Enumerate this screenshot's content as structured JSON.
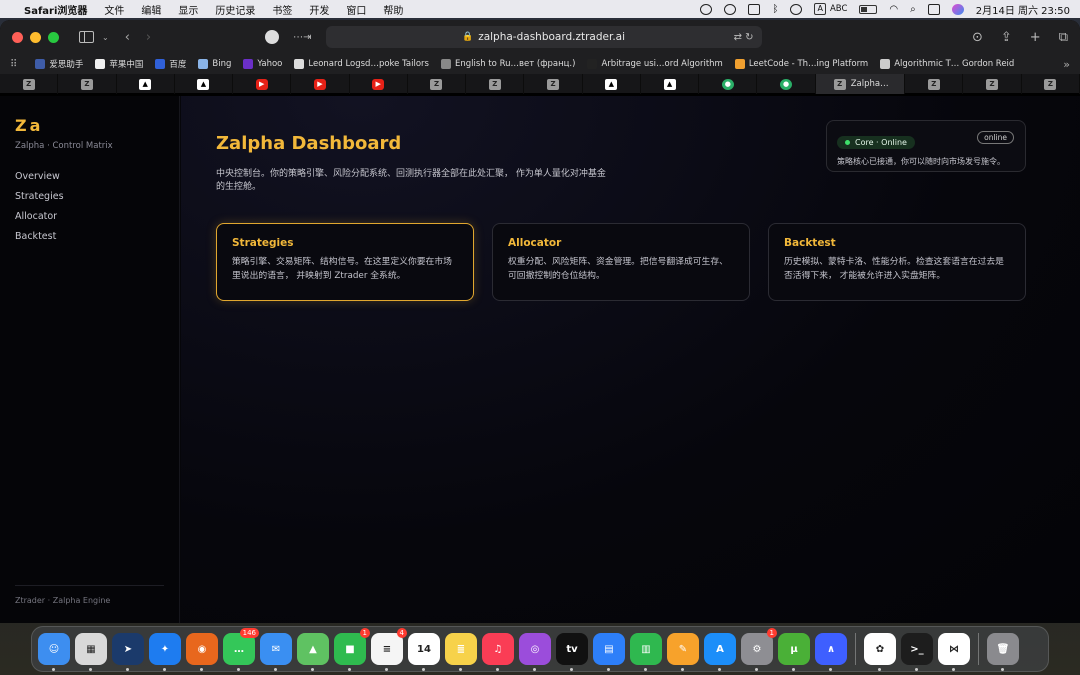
{
  "menubar": {
    "app_name": "Safari浏览器",
    "items": [
      "文件",
      "编辑",
      "显示",
      "历史记录",
      "书签",
      "开发",
      "窗口",
      "帮助"
    ],
    "input_method": "A",
    "input_label": "ABC",
    "datetime": "2月14日 周六 23:50"
  },
  "browser": {
    "url": "zalpha-dashboard.ztrader.ai",
    "bookmarks": [
      {
        "label": "爱思助手",
        "color": "#3e5ca8"
      },
      {
        "label": "苹果中国",
        "color": "#f0f0f0"
      },
      {
        "label": "百度",
        "color": "#3060d8"
      },
      {
        "label": "Bing",
        "color": "#8ab4e8"
      },
      {
        "label": "Yahoo",
        "color": "#6b2fc8"
      },
      {
        "label": "Leonard Logsd…poke Tailors",
        "color": "#dddddd"
      },
      {
        "label": "English to Ru…вет (франц.)",
        "color": "#888888"
      },
      {
        "label": "Arbitrage usi…ord Algorithm",
        "color": "#222222"
      },
      {
        "label": "LeetCode - Th…ing Platform",
        "color": "#f0a030"
      },
      {
        "label": "Algorithmic T… Gordon Reid",
        "color": "#cccccc"
      }
    ],
    "tabs": [
      {
        "type": "z",
        "glyph": "Z"
      },
      {
        "type": "z",
        "glyph": "Z"
      },
      {
        "type": "tri",
        "glyph": "▲"
      },
      {
        "type": "tri",
        "glyph": "▲"
      },
      {
        "type": "yt",
        "glyph": "▶"
      },
      {
        "type": "yt",
        "glyph": "▶"
      },
      {
        "type": "yt",
        "glyph": "▶"
      },
      {
        "type": "z",
        "glyph": "Z"
      },
      {
        "type": "z",
        "glyph": "Z"
      },
      {
        "type": "z",
        "glyph": "Z"
      },
      {
        "type": "tri",
        "glyph": "▲"
      },
      {
        "type": "tri",
        "glyph": "▲"
      },
      {
        "type": "wx",
        "glyph": "●"
      },
      {
        "type": "wx",
        "glyph": "●"
      },
      {
        "type": "z",
        "glyph": "Z",
        "label": "Zalpha…",
        "active": true
      },
      {
        "type": "z",
        "glyph": "Z"
      },
      {
        "type": "z",
        "glyph": "Z"
      },
      {
        "type": "z",
        "glyph": "Z"
      }
    ]
  },
  "sidebar": {
    "brand": "Za",
    "subtitle": "Zalpha · Control Matrix",
    "nav": [
      "Overview",
      "Strategies",
      "Allocator",
      "Backtest"
    ],
    "footer": "Ztrader · Zalpha Engine"
  },
  "main": {
    "title": "Zalpha Dashboard",
    "description": "中央控制台。你的策略引擎、风险分配系统、回测执行器全部在此处汇聚， 作为单人量化对冲基金的生控舱。",
    "status": {
      "pill": "Core · Online",
      "badge": "online",
      "text": "策略核心已接通，你可以随时向市场发号施令。"
    },
    "cards": [
      {
        "title": "Strategies",
        "desc": "策略引擎、交易矩阵、结构信号。在这里定义你要在市场里说出的语言， 并映射到 Ztrader 全系统。"
      },
      {
        "title": "Allocator",
        "desc": "权重分配、风险矩阵、资金管理。把信号翻译成可生存、可回撤控制的仓位结构。"
      },
      {
        "title": "Backtest",
        "desc": "历史模拟、蒙特卡洛、性能分析。检查这套语言在过去是否活得下来， 才能被允许进入实盘矩阵。"
      }
    ]
  },
  "dock": {
    "apps": [
      {
        "name": "finder",
        "color": "#3d8ef0",
        "glyph": "☺"
      },
      {
        "name": "launchpad",
        "color": "#d9d9d9",
        "glyph": "▦"
      },
      {
        "name": "navigator",
        "color": "#1b3a6b",
        "glyph": "➤"
      },
      {
        "name": "safari",
        "color": "#1e7cf0",
        "glyph": "✦"
      },
      {
        "name": "firefox",
        "color": "#e8671d",
        "glyph": "◉"
      },
      {
        "name": "messages",
        "color": "#34c759",
        "glyph": "…",
        "badge": "146"
      },
      {
        "name": "mail",
        "color": "#3a8ff2",
        "glyph": "✉"
      },
      {
        "name": "maps",
        "color": "#5fc262",
        "glyph": "▲"
      },
      {
        "name": "facetime",
        "color": "#2fbb4f",
        "glyph": "■",
        "badge": "1"
      },
      {
        "name": "reminders",
        "color": "#f5f5f5",
        "glyph": "≡",
        "badge": "4"
      },
      {
        "name": "calendar",
        "color": "#ffffff",
        "glyph": "14"
      },
      {
        "name": "notes",
        "color": "#f7d24a",
        "glyph": "≣"
      },
      {
        "name": "music",
        "color": "#fa3d55",
        "glyph": "♫"
      },
      {
        "name": "podcasts",
        "color": "#9b4ddb",
        "glyph": "◎"
      },
      {
        "name": "apple-tv",
        "color": "#111111",
        "glyph": "tv"
      },
      {
        "name": "keynote",
        "color": "#2d7ff9",
        "glyph": "▤"
      },
      {
        "name": "numbers",
        "color": "#2fb84f",
        "glyph": "▥"
      },
      {
        "name": "pages",
        "color": "#f7a22b",
        "glyph": "✎"
      },
      {
        "name": "app-store",
        "color": "#1c8ef9",
        "glyph": "A"
      },
      {
        "name": "system-settings",
        "color": "#8e8e93",
        "glyph": "⚙",
        "badge": "1"
      },
      {
        "name": "utorrent",
        "color": "#4ab037",
        "glyph": "µ"
      },
      {
        "name": "nordvpn",
        "color": "#3e5fff",
        "glyph": "∧"
      },
      {
        "name": "chatgpt",
        "color": "#ffffff",
        "glyph": "✿"
      },
      {
        "name": "terminal",
        "color": "#1d1d1d",
        "glyph": ">_"
      },
      {
        "name": "vscode",
        "color": "#ffffff",
        "glyph": "⋈"
      },
      {
        "name": "trash",
        "color": "#8a8a8e",
        "glyph": "🗑"
      }
    ]
  },
  "colors": {
    "accent": "#f2b83a",
    "online": "#3ee06a"
  }
}
